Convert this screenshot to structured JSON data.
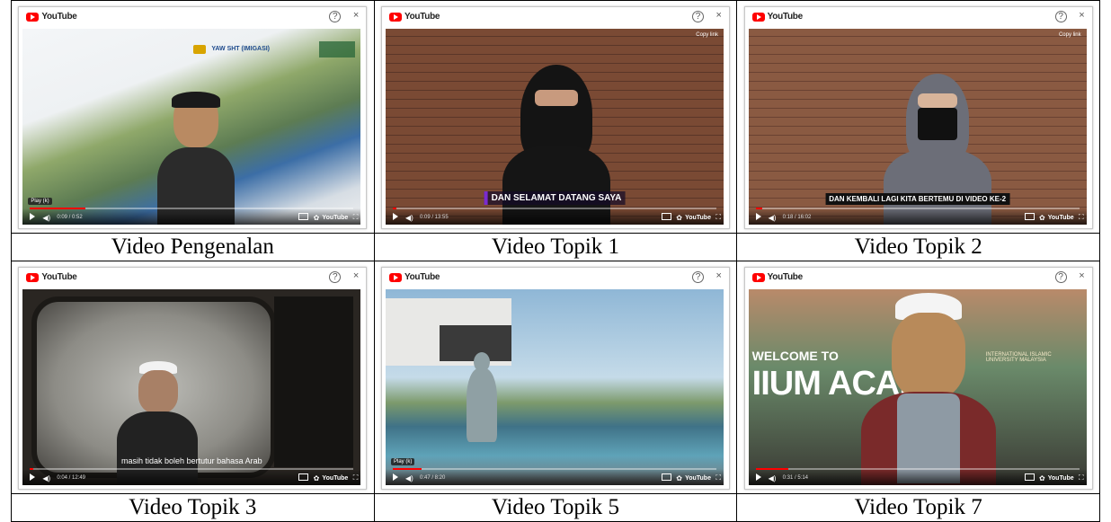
{
  "player": {
    "brand": "YouTube",
    "ctl_brand": "YouTube",
    "help_glyph": "?",
    "close_glyph": "×",
    "icons": [
      "youtube-logo-icon",
      "help-icon",
      "close-icon",
      "play-icon",
      "volume-icon",
      "captions-icon",
      "settings-icon",
      "fullscreen-icon"
    ]
  },
  "videos": [
    {
      "caption": "Video Pengenalan",
      "time": "0:09 / 0:52",
      "progress": 0.17,
      "play_hint": "Play (k)",
      "subtitle": "",
      "banner": "YAW SHT (IMIGASI)"
    },
    {
      "caption": "Video Topik 1",
      "time": "0:09 / 13:55",
      "progress": 0.01,
      "subtitle": "DAN SELAMAT DATANG SAYA",
      "copy_link": "Copy link"
    },
    {
      "caption": "Video Topik 2",
      "time": "0:18 / 16:02",
      "progress": 0.02,
      "subtitle": "DAN KEMBALI LAGI KITA BERTEMU DI VIDEO KE-2",
      "copy_link": "Copy link"
    },
    {
      "caption": "Video Topik 3",
      "time": "0:04 / 12:49",
      "progress": 0.01,
      "subtitle": "masih tidak boleh bertutur bahasa Arab"
    },
    {
      "caption": "Video Topik 5",
      "time": "0:47 / 8:20",
      "progress": 0.09,
      "play_hint": "Play (k)",
      "subtitle": ""
    },
    {
      "caption": "Video Topik 7",
      "time": "0:31 / 5:14",
      "progress": 0.1,
      "subtitle": "",
      "title_text_1": "WELCOME TO",
      "title_text_2": "IIUM ACAD",
      "sign_text": "INTERNATIONAL ISLAMIC UNIVERSITY MALAYSIA"
    }
  ]
}
